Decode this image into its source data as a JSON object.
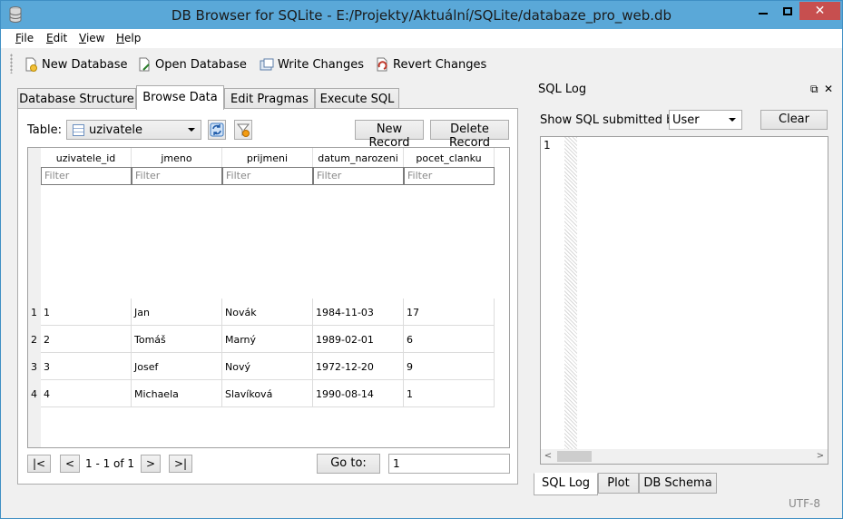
{
  "window": {
    "title": "DB Browser for SQLite - E:/Projekty/Aktuální/SQLite/databaze_pro_web.db"
  },
  "menu": [
    {
      "key": "F",
      "rest": "ile"
    },
    {
      "key": "E",
      "rest": "dit"
    },
    {
      "key": "V",
      "rest": "iew"
    },
    {
      "key": "H",
      "rest": "elp"
    }
  ],
  "toolbar": {
    "new_db": "New Database",
    "open_db": "Open Database",
    "write": "Write Changes",
    "revert": "Revert Changes"
  },
  "tabs": [
    "Database Structure",
    "Browse Data",
    "Edit Pragmas",
    "Execute SQL"
  ],
  "browse": {
    "table_label": "Table:",
    "table_value": "uzivatele",
    "new_record": "New Record",
    "delete_record": "Delete Record",
    "columns": [
      "uzivatele_id",
      "jmeno",
      "prijmeni",
      "datum_narozeni",
      "pocet_clanku"
    ],
    "filter_placeholder": "Filter",
    "row_numbers": [
      "1",
      "2",
      "3",
      "4"
    ],
    "rows": [
      [
        "1",
        "Jan",
        "Novák",
        "1984-11-03",
        "17"
      ],
      [
        "2",
        "Tomáš",
        "Marný",
        "1989-02-01",
        "6"
      ],
      [
        "3",
        "Josef",
        "Nový",
        "1972-12-20",
        "9"
      ],
      [
        "4",
        "Michaela",
        "Slavíková",
        "1990-08-14",
        "1"
      ]
    ],
    "nav": {
      "first": "|<",
      "prev": "<",
      "info": "1 - 1 of 1",
      "next": ">",
      "last": ">|"
    },
    "goto_label": "Go to:",
    "goto_value": "1"
  },
  "sql_log": {
    "title": "SQL Log",
    "show_label": "Show SQL submitted by",
    "submitted_by": "User",
    "clear": "Clear",
    "line_number": "1"
  },
  "dock_tabs": [
    "SQL Log",
    "Plot",
    "DB Schema"
  ],
  "status": {
    "encoding": "UTF-8"
  }
}
